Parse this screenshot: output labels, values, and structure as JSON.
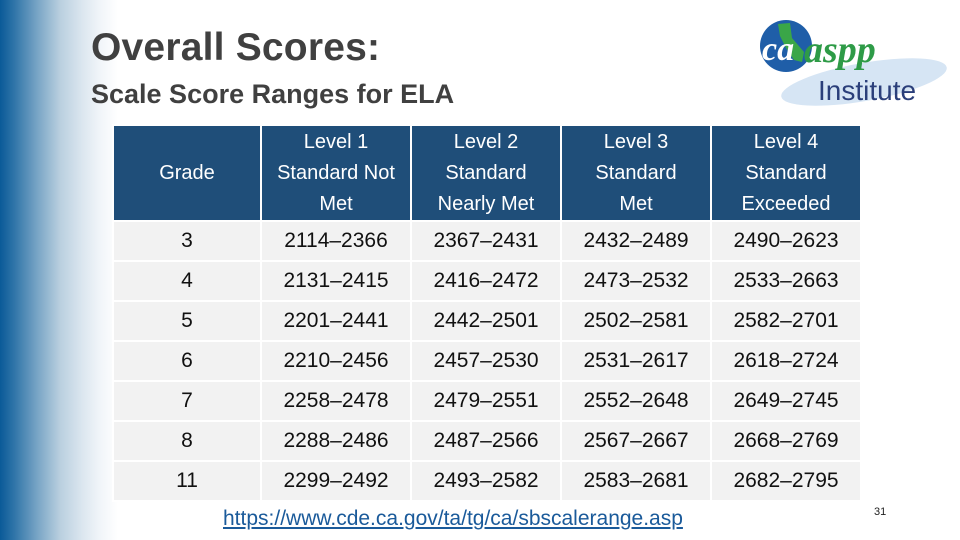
{
  "slide": {
    "title": "Overall Scores:",
    "subtitle": "Scale Score Ranges for ELA",
    "page_number": "31"
  },
  "logo": {
    "brand_text": "caaspp",
    "sub_text": "Institute",
    "colors": {
      "globe": "#1f5ea8",
      "state": "#3aa648",
      "brand": "#2e9b47",
      "sub": "#2b3f7a",
      "swoosh": "#cfe0f2"
    }
  },
  "table": {
    "headers": [
      {
        "lines": [
          "Grade"
        ]
      },
      {
        "lines": [
          "Level 1",
          "Standard Not",
          "Met"
        ]
      },
      {
        "lines": [
          "Level 2",
          "Standard",
          "Nearly Met"
        ]
      },
      {
        "lines": [
          "Level 3",
          "Standard",
          "Met"
        ]
      },
      {
        "lines": [
          "Level 4",
          "Standard",
          "Exceeded"
        ]
      }
    ],
    "rows": [
      [
        "3",
        "2114–2366",
        "2367–2431",
        "2432–2489",
        "2490–2623"
      ],
      [
        "4",
        "2131–2415",
        "2416–2472",
        "2473–2532",
        "2533–2663"
      ],
      [
        "5",
        "2201–2441",
        "2442–2501",
        "2502–2581",
        "2582–2701"
      ],
      [
        "6",
        "2210–2456",
        "2457–2530",
        "2531–2617",
        "2618–2724"
      ],
      [
        "7",
        "2258–2478",
        "2479–2551",
        "2552–2648",
        "2649–2745"
      ],
      [
        "8",
        "2288–2486",
        "2487–2566",
        "2567–2667",
        "2668–2769"
      ],
      [
        "11",
        "2299–2492",
        "2493–2582",
        "2583–2681",
        "2682–2795"
      ]
    ],
    "colors": {
      "header_bg": "#1f4e79",
      "header_text": "#ffffff",
      "cell_bg": "#f2f2f2"
    }
  },
  "footer": {
    "source_link": "https://www.cde.ca.gov/ta/tg/ca/sbscalerange.asp"
  },
  "theme": {
    "accent_blue": "#0a5a98",
    "title_color": "#404040",
    "link_color": "#1a5a9a"
  }
}
